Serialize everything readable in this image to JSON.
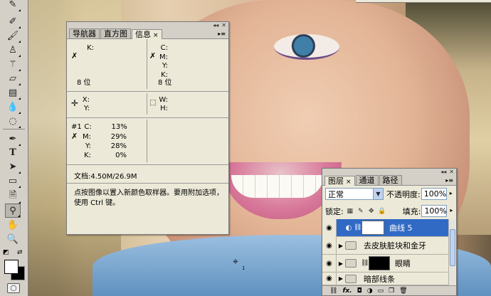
{
  "info_panel": {
    "tabs": [
      {
        "label": "导航器"
      },
      {
        "label": "直方图"
      },
      {
        "label": "信息",
        "close": "×"
      }
    ],
    "menu_icon": "menu-arrow-icon",
    "block1_left": {
      "k_label": "K:",
      "bits": "8 位"
    },
    "block1_right": {
      "c_label": "C:",
      "m_label": "M:",
      "y_label": "Y:",
      "k_label": "K:",
      "bits": "8 位"
    },
    "xy": {
      "x_label": "X:",
      "y_label": "Y:"
    },
    "wh": {
      "w_label": "W:",
      "h_label": "H:"
    },
    "sampler": {
      "number": "#1",
      "c_label": "C:",
      "c_value": "13%",
      "m_label": "M:",
      "m_value": "29%",
      "y_label": "Y:",
      "y_value": "28%",
      "k_label": "K:",
      "k_value": "0%"
    },
    "doc": "文档:4.50M/26.9M",
    "hint": "点按图像以置入新颜色取样器。要用附加选项，使用 Ctrl 键。"
  },
  "layers_panel": {
    "tabs": [
      {
        "label": "图层",
        "close": "×"
      },
      {
        "label": "通道"
      },
      {
        "label": "路径"
      }
    ],
    "blend_mode": "正常",
    "opacity_label": "不透明度:",
    "opacity_value": "100%",
    "lock_label": "锁定:",
    "fill_label": "填充:",
    "fill_value": "100%",
    "layers": [
      {
        "name": "曲线 5",
        "type": "adjustment",
        "selected": true
      },
      {
        "name": "去皮肤脏块和金牙",
        "type": "group"
      },
      {
        "name": "眼睛",
        "type": "group-mask"
      },
      {
        "name": "暗部线条",
        "type": "group"
      }
    ],
    "footer_icons": [
      "link-icon",
      "fx-icon",
      "mask-icon",
      "adjustment-icon",
      "folder-icon",
      "new-layer-icon",
      "trash-icon"
    ],
    "footer_labels": {
      "fx": "fx."
    }
  },
  "tools": [
    "brush-icon",
    "brush-icon",
    "clone-stamp-icon",
    "history-brush-icon",
    "eraser-icon",
    "gradient-icon",
    "blur-icon",
    "dodge-icon",
    "pen-icon",
    "type-icon",
    "path-select-icon",
    "rectangle-icon",
    "notes-icon",
    "eyedropper-icon",
    "hand-icon",
    "zoom-icon"
  ],
  "tool_glyphs": {
    "type": "T"
  },
  "colors": {
    "foreground": "#ffffff",
    "background": "#000000",
    "selection": "#316ac5"
  },
  "cursor": {
    "sample_index": "1"
  }
}
